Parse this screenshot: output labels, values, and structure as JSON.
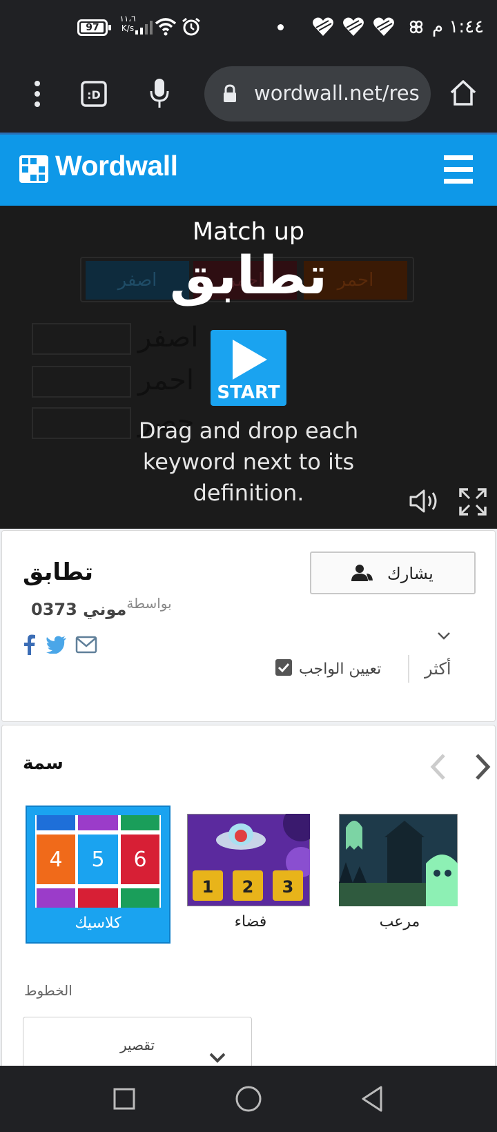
{
  "status_bar": {
    "battery": "97",
    "battery_level": 0.97,
    "net_speed_value": "١١،٦",
    "net_speed_unit": "K/s",
    "time": "١:٤٤ م"
  },
  "browser": {
    "url": "wordwall.net/res"
  },
  "site": {
    "logo": "Wordwall"
  },
  "game": {
    "title_en": "Match up",
    "title_ar": "تطابق",
    "start_label": "START",
    "instructions": "Drag and drop each keyword next to its definition.",
    "bg_tiles": [
      "اصفر",
      "احمر",
      "احمر"
    ],
    "bg_rows": [
      "اصفر",
      "احمر",
      "حصر"
    ]
  },
  "activity": {
    "title": "تطابق",
    "by_prefix": "بواسطة",
    "author": "موني 0373",
    "share_label": "يشارك",
    "assign_label": "تعيين الواجب",
    "more_label": "أكثر"
  },
  "theme": {
    "heading": "سمة",
    "items": [
      {
        "label": "كلاسيك",
        "selected": true
      },
      {
        "label": "فضاء",
        "selected": false
      },
      {
        "label": "مرعب",
        "selected": false
      }
    ],
    "classic_numbers": [
      "4",
      "5",
      "6"
    ],
    "space_numbers": [
      "1",
      "2",
      "3"
    ],
    "fonts_label": "الخطوط",
    "font_value": "تقصير"
  },
  "colors": {
    "brand": "#0e98e8",
    "selected_theme": "#1aa3f0"
  }
}
